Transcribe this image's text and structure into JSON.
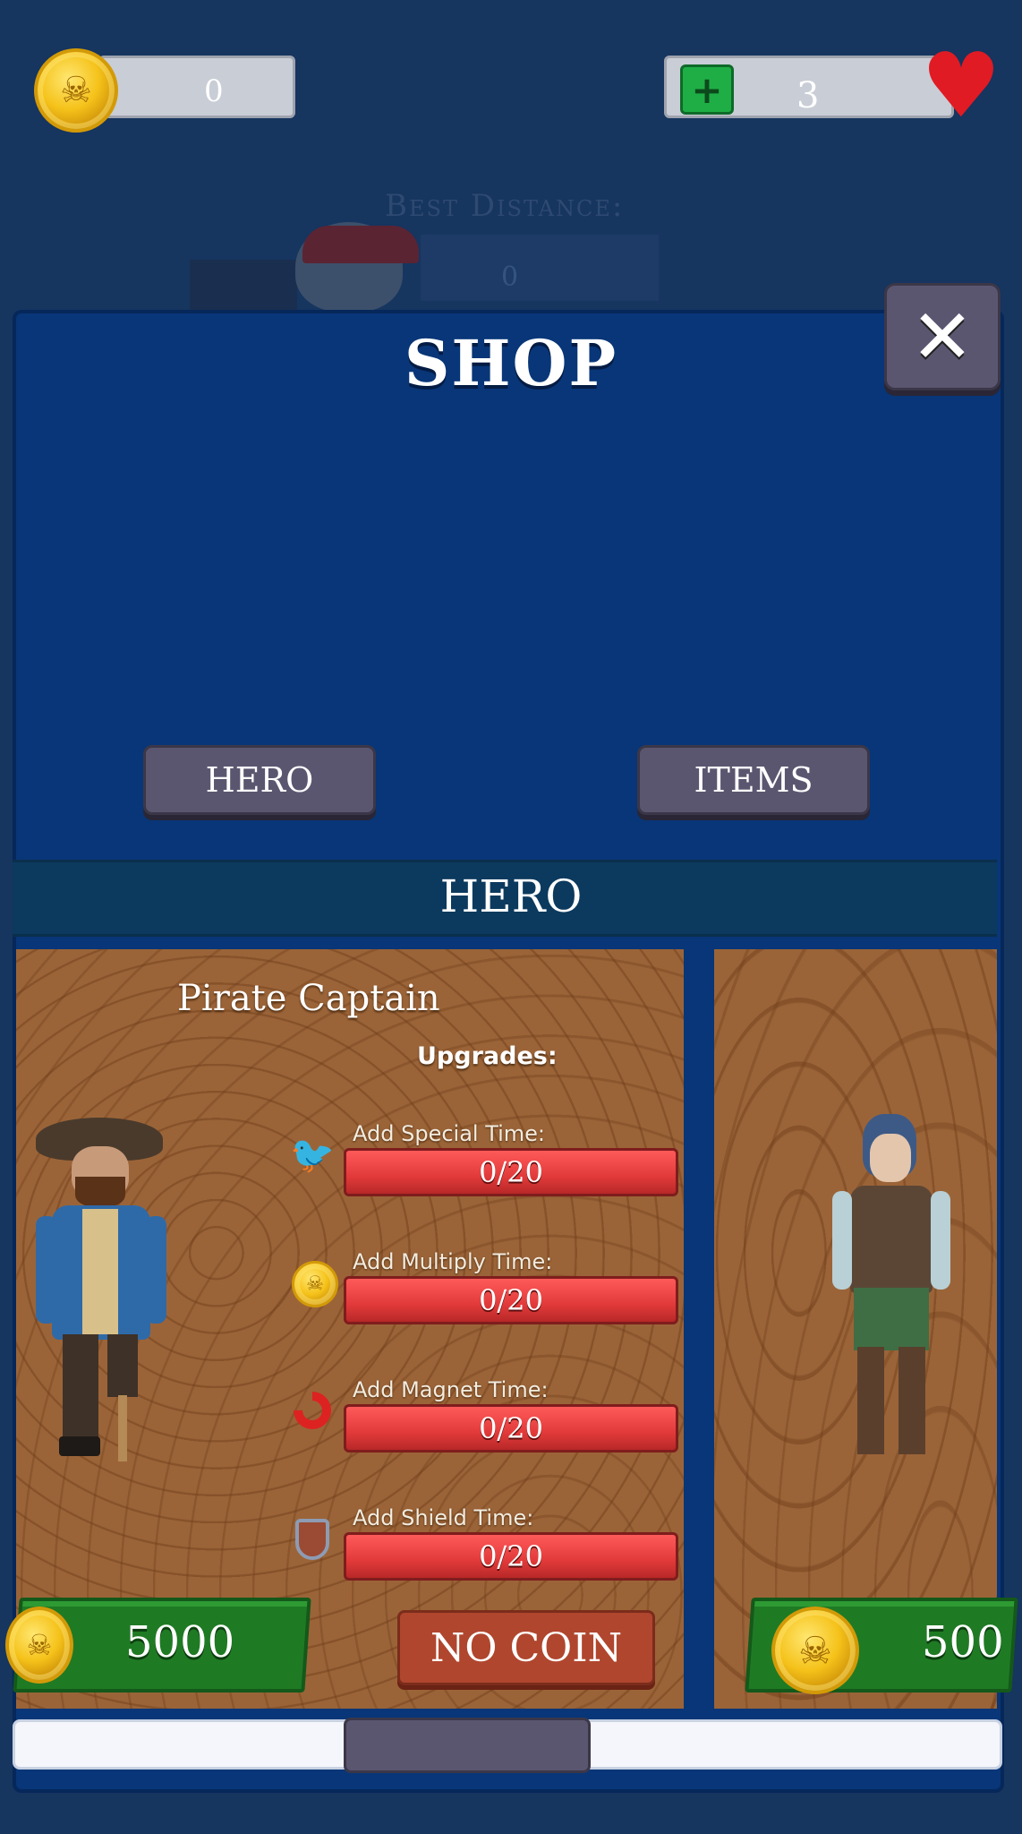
{
  "hud": {
    "coins_value": "0",
    "lives_value": "3",
    "coin_icon": "skull-coin-icon",
    "add_icon": "plus-icon",
    "lives_icon": "heart-icon"
  },
  "background": {
    "best_distance_label": "Best Distance:",
    "best_distance_value": "0"
  },
  "shop": {
    "title": "SHOP",
    "close_icon": "close-icon",
    "tabs": [
      {
        "label": "HERO"
      },
      {
        "label": "ITEMS"
      }
    ],
    "section_title": "HERO",
    "heroes": [
      {
        "name": "Pirate Captain",
        "upgrades_label": "Upgrades:",
        "upgrades": [
          {
            "label": "Add Special Time:",
            "progress": "0/20",
            "icon": "parrot-icon"
          },
          {
            "label": "Add Multiply Time:",
            "progress": "0/20",
            "icon": "coin-x2-icon"
          },
          {
            "label": "Add Magnet Time:",
            "progress": "0/20",
            "icon": "magnet-icon"
          },
          {
            "label": "Add Shield Time:",
            "progress": "0/20",
            "icon": "shield-icon"
          }
        ],
        "price": "5000",
        "buy_label": "NO COIN"
      },
      {
        "name": "",
        "price": "500"
      }
    ]
  },
  "colors": {
    "panel": "#083678",
    "background": "#16355f",
    "button": "#5b5670",
    "upgrade_bar": "#e23a3a",
    "price_plank": "#1f7a24",
    "nocoin_button": "#b0462e",
    "card_wood": "#9b6438"
  }
}
